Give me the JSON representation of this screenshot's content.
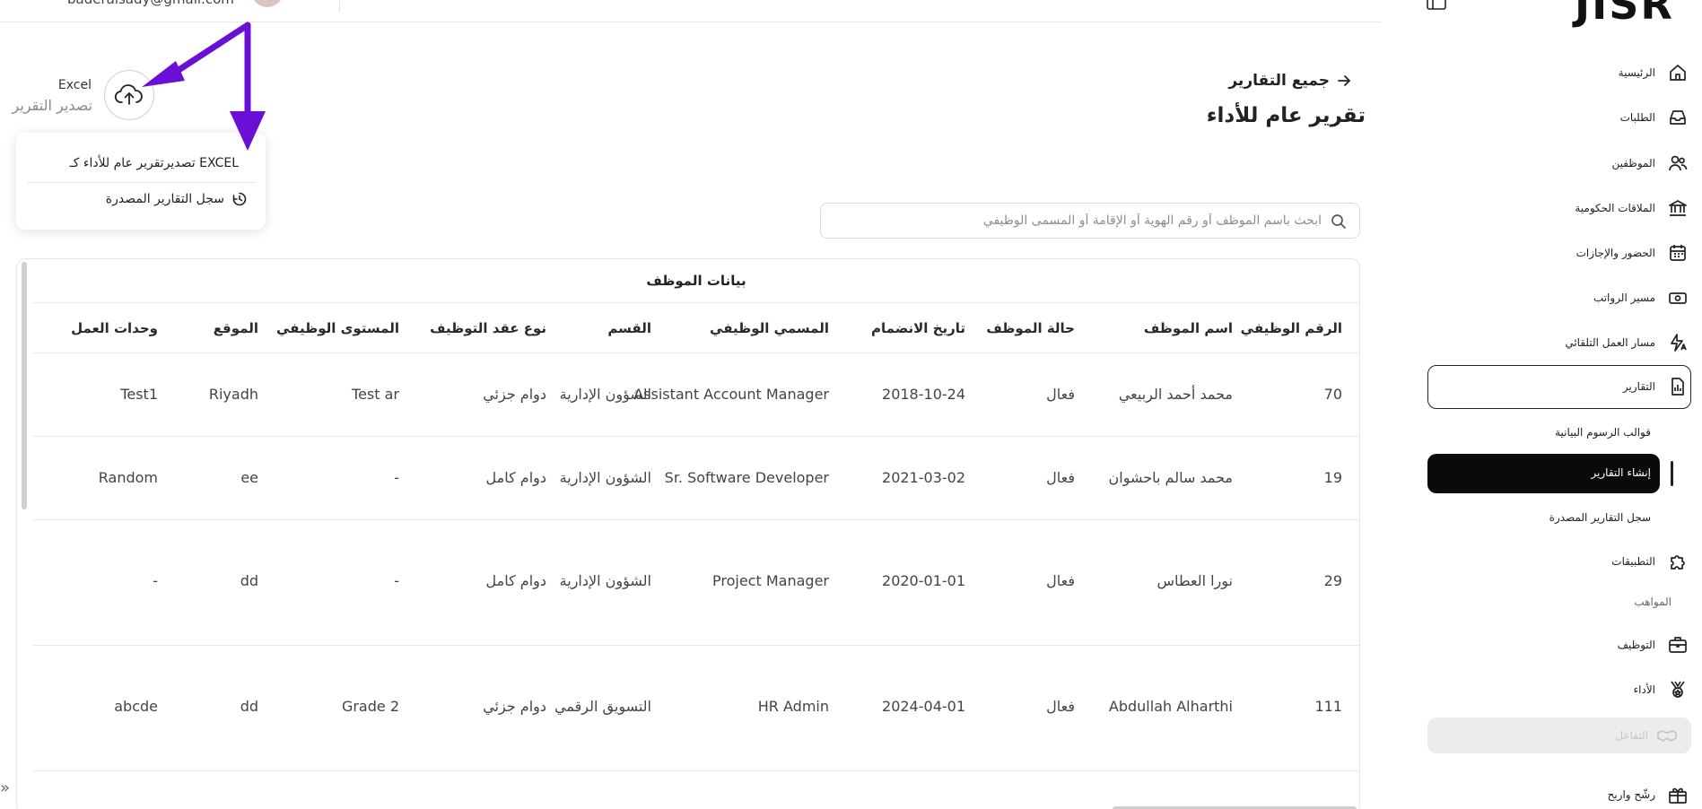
{
  "topbar": {
    "email": "baderalsady@gmail.com"
  },
  "export": {
    "format": "Excel",
    "label": "تصدير التقرير",
    "menu": {
      "export_item": "تصديرتقرير عام للأداء كـ EXCEL",
      "history_item": "سجل التقارير المصدرة"
    }
  },
  "header": {
    "back_label": "جميع التقارير",
    "title": "تقرير عام للأداء"
  },
  "search": {
    "placeholder": "ابحث باسم الموظف أو رقم الهوية أو الإقامة أو المسمى الوظيفي",
    "value": ""
  },
  "table": {
    "group_header": "بيانات الموظف",
    "columns": {
      "employee_id": "الرقم الوظيفي",
      "name": "اسم الموظف",
      "status": "حالة الموظف",
      "join_date": "تاريخ الانضمام",
      "job_title": "المسمي الوظيفي",
      "department": "القسم",
      "contract": "نوع عقد التوظيف",
      "level": "المستوى الوظيفي",
      "location": "الموقع",
      "units": "وحدات العمل"
    },
    "rows": [
      {
        "employee_id": "70",
        "name": "محمد أحمد الربيعي",
        "status": "فعال",
        "join_date": "2018-10-24",
        "job_title": "Assistant Account Manager",
        "department": "الشؤون الإدارية",
        "contract": "دوام جزئي",
        "level": "Test ar",
        "location": "Riyadh",
        "units": "Test1"
      },
      {
        "employee_id": "19",
        "name": "محمد سالم باحشوان",
        "status": "فعال",
        "join_date": "2021-03-02",
        "job_title": "Sr. Software Developer",
        "department": "الشؤون الإدارية",
        "contract": "دوام كامل",
        "level": "-",
        "location": "ee",
        "units": "Random"
      },
      {
        "employee_id": "29",
        "name": "نورا العطاس",
        "status": "فعال",
        "join_date": "2020-01-01",
        "job_title": "Project Manager",
        "department": "الشؤون الإدارية",
        "contract": "دوام كامل",
        "level": "-",
        "location": "dd",
        "units": "-"
      },
      {
        "employee_id": "111",
        "name": "Abdullah Alharthi",
        "status": "فعال",
        "join_date": "2024-04-01",
        "job_title": "HR Admin",
        "department": "التسويق الرقمي",
        "contract": "دوام جزئي",
        "level": "Grade 2",
        "location": "dd",
        "units": "abcde"
      }
    ]
  },
  "sidebar": {
    "logo": "JISR",
    "items": [
      {
        "key": "home",
        "label": "الرئيسية",
        "icon": "home-icon"
      },
      {
        "key": "requests",
        "label": "الطلبات",
        "icon": "inbox-icon"
      },
      {
        "key": "employees",
        "label": "الموظفين",
        "icon": "users-icon"
      },
      {
        "key": "gov",
        "label": "الملاقات الحكومية",
        "icon": "bank-icon"
      },
      {
        "key": "attendance",
        "label": "الحضور والإجازات",
        "icon": "calendar-icon"
      },
      {
        "key": "payroll",
        "label": "مسير الرواتب",
        "icon": "cash-icon"
      },
      {
        "key": "workflow",
        "label": "مسار العمل التلقائي",
        "icon": "automation-icon"
      },
      {
        "key": "reports",
        "label": "التقارير",
        "icon": "report-icon"
      }
    ],
    "report_subitems": [
      {
        "label": "قوالب الرسوم البيانية"
      },
      {
        "label": "إنشاء التقارير"
      },
      {
        "label": "سجل التقارير المصدرة"
      }
    ],
    "apps_label": "التطبيقات",
    "talent_section": "المواهب",
    "hiring_label": "التوظيف",
    "performance_label": "الأداء",
    "interaction_label": "التفاعل",
    "nominate_label": "رشّح واربح",
    "colors": {
      "active_bg": "#0a0a0a",
      "annotation": "#6a0fd6"
    }
  }
}
